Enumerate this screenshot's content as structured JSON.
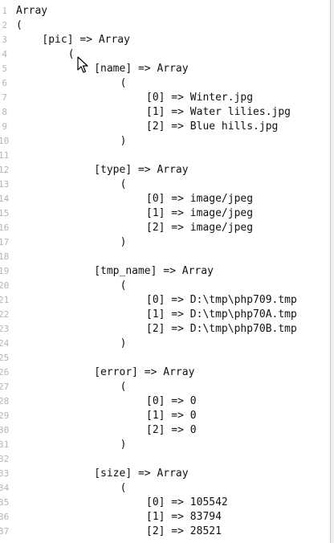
{
  "editor": {
    "lines": [
      {
        "num": "1",
        "text": "Array",
        "indent": 0
      },
      {
        "num": "2",
        "text": "(",
        "indent": 0
      },
      {
        "num": "3",
        "text": "[pic] => Array",
        "indent": 4
      },
      {
        "num": "4",
        "text": "(",
        "indent": 8
      },
      {
        "num": "5",
        "text": "[name] => Array",
        "indent": 12
      },
      {
        "num": "6",
        "text": "(",
        "indent": 16
      },
      {
        "num": "7",
        "text": "[0] => Winter.jpg",
        "indent": 20
      },
      {
        "num": "8",
        "text": "[1] => Water lilies.jpg",
        "indent": 20
      },
      {
        "num": "9",
        "text": "[2] => Blue hills.jpg",
        "indent": 20
      },
      {
        "num": "10",
        "text": ")",
        "indent": 16
      },
      {
        "num": "11",
        "text": "",
        "indent": 0
      },
      {
        "num": "12",
        "text": "[type] => Array",
        "indent": 12
      },
      {
        "num": "13",
        "text": "(",
        "indent": 16
      },
      {
        "num": "14",
        "text": "[0] => image/jpeg",
        "indent": 20
      },
      {
        "num": "15",
        "text": "[1] => image/jpeg",
        "indent": 20
      },
      {
        "num": "16",
        "text": "[2] => image/jpeg",
        "indent": 20
      },
      {
        "num": "17",
        "text": ")",
        "indent": 16
      },
      {
        "num": "18",
        "text": "",
        "indent": 0
      },
      {
        "num": "19",
        "text": "[tmp_name] => Array",
        "indent": 12
      },
      {
        "num": "20",
        "text": "(",
        "indent": 16
      },
      {
        "num": "21",
        "text": "[0] => D:\\tmp\\php709.tmp",
        "indent": 20
      },
      {
        "num": "22",
        "text": "[1] => D:\\tmp\\php70A.tmp",
        "indent": 20
      },
      {
        "num": "23",
        "text": "[2] => D:\\tmp\\php70B.tmp",
        "indent": 20
      },
      {
        "num": "24",
        "text": ")",
        "indent": 16
      },
      {
        "num": "25",
        "text": "",
        "indent": 0
      },
      {
        "num": "26",
        "text": "[error] => Array",
        "indent": 12
      },
      {
        "num": "27",
        "text": "(",
        "indent": 16
      },
      {
        "num": "28",
        "text": "[0] => 0",
        "indent": 20
      },
      {
        "num": "29",
        "text": "[1] => 0",
        "indent": 20
      },
      {
        "num": "30",
        "text": "[2] => 0",
        "indent": 20
      },
      {
        "num": "31",
        "text": ")",
        "indent": 16
      },
      {
        "num": "32",
        "text": "",
        "indent": 0
      },
      {
        "num": "33",
        "text": "[size] => Array",
        "indent": 12
      },
      {
        "num": "34",
        "text": "(",
        "indent": 16
      },
      {
        "num": "35",
        "text": "[0] => 105542",
        "indent": 20
      },
      {
        "num": "36",
        "text": "[1] => 83794",
        "indent": 20
      },
      {
        "num": "37",
        "text": "[2] => 28521",
        "indent": 20
      }
    ]
  },
  "cursor": {
    "icon": "mouse-pointer-icon"
  },
  "colors": {
    "text": "#111111",
    "line_number": "#b4b4b4",
    "background": "#ffffff"
  }
}
